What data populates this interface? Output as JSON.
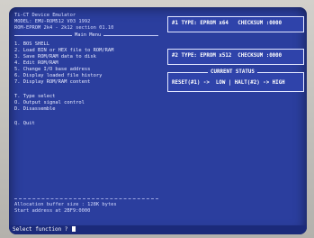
{
  "header": {
    "line1": "Ti-CT Device Emulator",
    "line2": "MODEL: EMU-ROM512 V03 1992",
    "line3": "ROM-EPROM 2k4 - 2k12 section 01.10"
  },
  "menu": {
    "title": "Main Menu",
    "items": [
      "1. BOS SHELL",
      "2. Load BIN or HEX file to ROM/RAM",
      "3. Save ROM/RAM data to disk",
      "4. Edit ROM/RAM",
      "5. Change I/O base address",
      "6. Display loaded file history",
      "7. Display ROM/RAM content",
      "T. Type select",
      "O. Output signal control",
      "D. Disassemble",
      "Q. Quit"
    ]
  },
  "info": {
    "buffer": "Allocation buffer size : 128K bytes",
    "start": "Start address at 2BF9:0000"
  },
  "prompt": {
    "text": "Select function ? "
  },
  "panel1": {
    "text": "#1 TYPE: EPROM x64   CHECKSUM :0000"
  },
  "panel2": {
    "text": "#2 TYPE: EPROM x512  CHECKSUM :0000"
  },
  "status": {
    "title": "CURRENT STATUS",
    "line": "RESET(#1) ->  LOW | HALT(#2) -> HIGH"
  },
  "colors": {
    "screen_bg": "#2b3e9e",
    "text": "#e8ebff",
    "bezel": "#b9b7b2"
  }
}
